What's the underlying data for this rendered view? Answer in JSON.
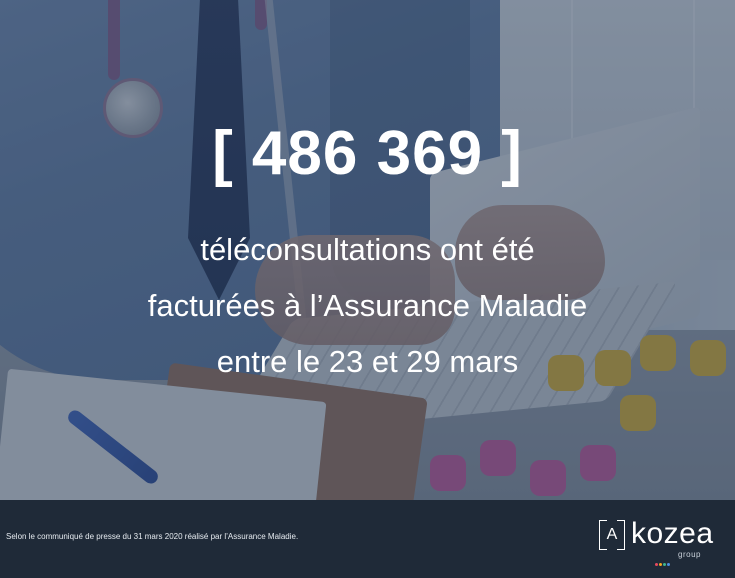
{
  "headline": "[ 486 369 ]",
  "subtext": {
    "line1": "téléconsultations ont été",
    "line2": "facturées à l’Assurance Maladie",
    "line3": "entre le 23 et 29 mars"
  },
  "footer": {
    "source": "Selon le communiqué de presse du 31 mars 2020 réalisé par l’Assurance Maladie."
  },
  "logo": {
    "letter": "A",
    "word": "kozea",
    "sub": "group",
    "dot_colors": [
      "#e84a5f",
      "#f5a623",
      "#3fb68e",
      "#4a90e2"
    ]
  },
  "colors": {
    "footer_bg": "#1f2a38",
    "text": "#ffffff"
  }
}
